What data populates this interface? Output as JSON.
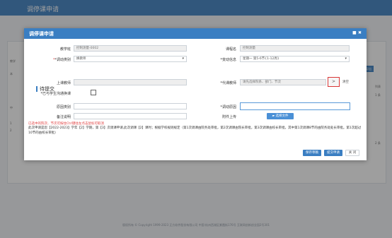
{
  "app": {
    "title": "调停课申请",
    "footer": "版权所有 © Copyright 1999-2023 正方软件股份有限公司    中国·杭州西湖区紫霞街176号 互联网创新创业园2号301"
  },
  "background": {
    "side_labels": [
      "教学",
      "本",
      "中",
      "1",
      "2"
    ],
    "right_button": "导出",
    "right_texts": [
      "列表",
      "1 条",
      "2 条"
    ]
  },
  "modal": {
    "title": "调停课申请",
    "controls": [
      "■",
      "✖"
    ],
    "fields": {
      "teaching_class": {
        "label": "教学班",
        "value": "控制测量-0002"
      },
      "course_name": {
        "label": "课程名",
        "value": "控制测量"
      },
      "change_type": {
        "label": "*调动类别",
        "value": "换教师"
      },
      "change_info": {
        "label": "*变动信息",
        "value": "星期一 第5-6节{1-12周}"
      },
      "teacher": {
        "label": "上课教师",
        "value": ""
      },
      "sub_teacher": {
        "label": "*代课教师",
        "placeholder": "请先选择院系、部门、节次"
      },
      "notified": {
        "label": "*已与学生沟通换课"
      },
      "original_type": {
        "label": "原因类别",
        "value": ""
      },
      "reason": {
        "label": "*调动原因",
        "value": ""
      },
      "remark": {
        "label": "备注说明",
        "value": ""
      },
      "attachment": {
        "label": "附件上传",
        "button": "选择文件"
      }
    },
    "section_title": "待提交",
    "picker_button": ">",
    "clear_link": "清空",
    "notice_red": "已选中的院次、节次可按住Ctrl键往左点击鼠标可取消",
    "notice_text": "此次申请是您【2022-2023】学年【2】学期，第【3】次调课申请,此次调课【2】课时；根据学校规则规定（第1次调课由院务处审批，第2次调课由院长审批，第3次调课由校长审批，其中第1次调课8节的由院务处处长审批。第1次超过10节的由校长审批）",
    "buttons": {
      "save": "保存草稿",
      "submit": "提交申请",
      "close": "关 闭"
    }
  },
  "colors": {
    "primary": "#3a7ec2",
    "required": "#e03b3b",
    "highlight": "#d93636"
  }
}
